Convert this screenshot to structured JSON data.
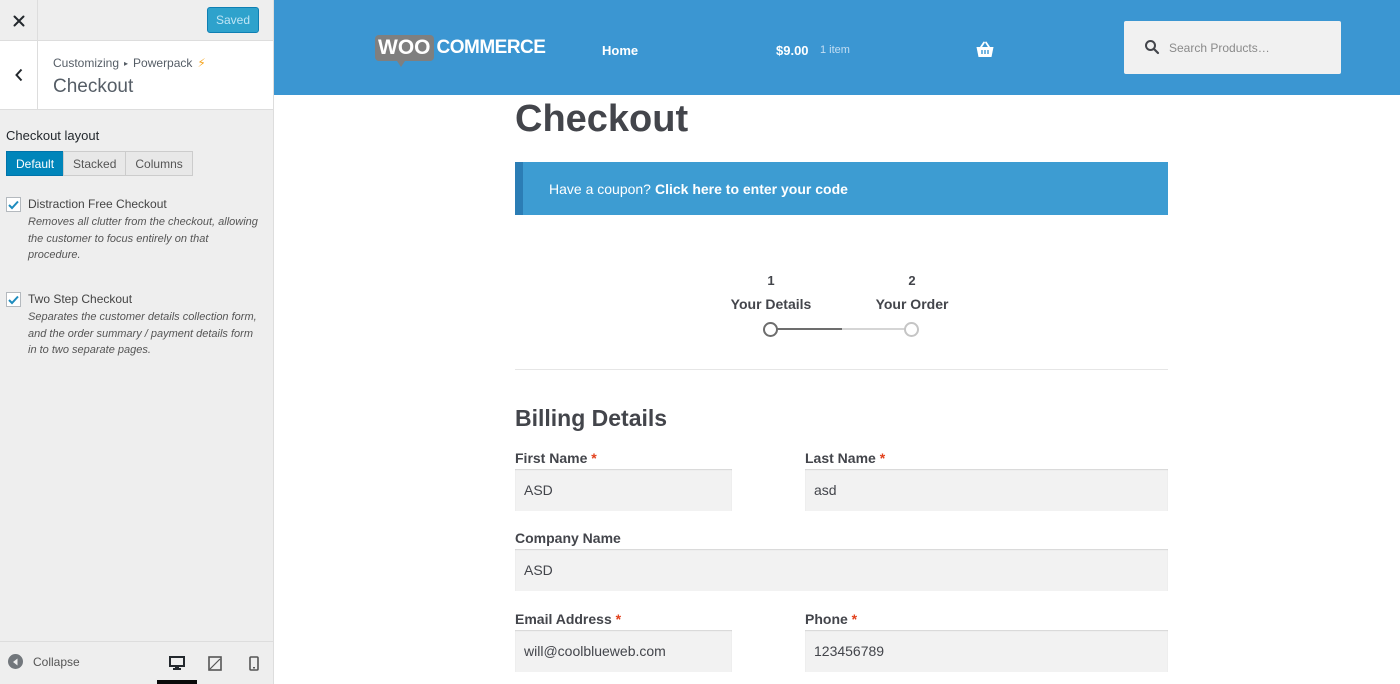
{
  "sidebar": {
    "save_label": "Saved",
    "breadcrumb": {
      "root": "Customizing",
      "section": "Powerpack",
      "bolt": "⚡"
    },
    "title": "Checkout",
    "layout_label": "Checkout layout",
    "layout_options": [
      "Default",
      "Stacked",
      "Columns"
    ],
    "layout_selected": "Default",
    "options": [
      {
        "label": "Distraction Free Checkout",
        "checked": true,
        "description": "Removes all clutter from the checkout, allowing the customer to focus entirely on that procedure."
      },
      {
        "label": "Two Step Checkout",
        "checked": true,
        "description": "Separates the customer details collection form, and the order summary / payment details form in to two separate pages."
      }
    ],
    "collapse_label": "Collapse",
    "devices": [
      "desktop-icon",
      "tablet-icon",
      "mobile-icon"
    ],
    "active_device": "desktop"
  },
  "header": {
    "logo_woo": "WOO",
    "logo_commerce": "COMMERCE",
    "nav_home": "Home",
    "cart_total": "$9.00",
    "cart_count": "1 item",
    "search_placeholder": "Search Products…"
  },
  "page": {
    "title": "Checkout",
    "coupon_text": "Have a coupon?",
    "coupon_link": "Click here to enter your code",
    "steps": [
      {
        "num": "1",
        "label": "Your Details"
      },
      {
        "num": "2",
        "label": "Your Order"
      }
    ],
    "billing_title": "Billing Details",
    "fields": {
      "first_name": {
        "label": "First Name",
        "value": "ASD",
        "required": "*"
      },
      "last_name": {
        "label": "Last Name",
        "value": "asd",
        "required": "*"
      },
      "company": {
        "label": "Company Name",
        "value": "ASD"
      },
      "email": {
        "label": "Email Address",
        "value": "will@coolblueweb.com",
        "required": "*"
      },
      "phone": {
        "label": "Phone",
        "value": "123456789",
        "required": "*"
      }
    }
  },
  "colors": {
    "header_bg": "#3b96d2",
    "coupon_bg": "#3d9cd2",
    "wp_blue": "#0085ba",
    "required": "#e2401c"
  }
}
